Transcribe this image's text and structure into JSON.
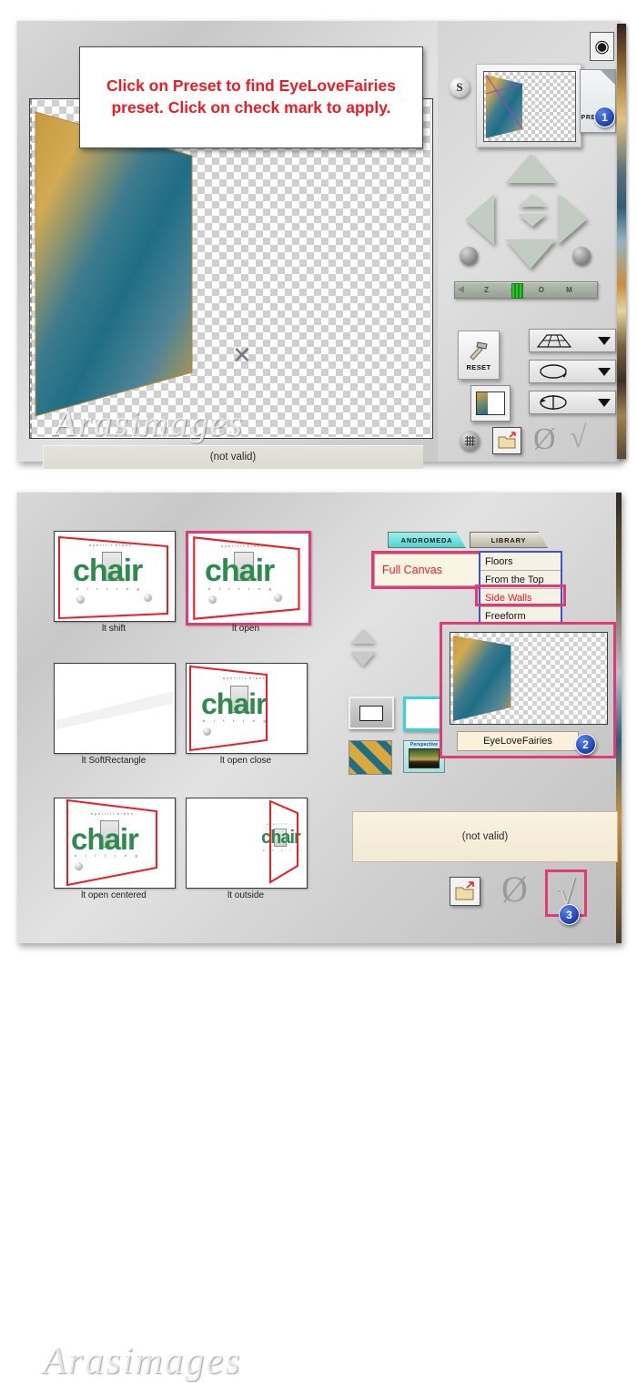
{
  "callout": {
    "text": "Click on Preset to find EyeLoveFairies preset.  Click on check mark to apply.",
    "color": "#ec1c24"
  },
  "top_panel": {
    "s_button_label": "S",
    "camera_icon": "camera-icon",
    "presets_button_label": "PRESETS",
    "presets_badge": "1",
    "zoom_slider_label": "Z O O M",
    "reset_button_label": "RESET",
    "status_text": "(not valid)",
    "watermark": "Arasimages",
    "dropdowns": [
      {
        "name": "perspective-grid-dropdown"
      },
      {
        "name": "rotate-dropdown"
      },
      {
        "name": "flip-dropdown"
      }
    ],
    "actions": [
      {
        "name": "grid-icon"
      },
      {
        "name": "open-folder-icon"
      },
      {
        "name": "cancel-null-icon"
      },
      {
        "name": "apply-check-icon"
      }
    ]
  },
  "bottom_panel": {
    "tabs": [
      {
        "label": "ANDROMEDA",
        "active": true
      },
      {
        "label": "LIBRARY",
        "active": false
      }
    ],
    "category_label": "Full Canvas",
    "menu_items": [
      {
        "label": "Floors",
        "highlighted": false
      },
      {
        "label": "From the Top",
        "highlighted": false
      },
      {
        "label": "Side Walls",
        "highlighted": true
      },
      {
        "label": "Freeform",
        "highlighted": false
      }
    ],
    "thumbnails": [
      {
        "label": "lt shift",
        "selected": false
      },
      {
        "label": "lt open",
        "selected": true
      },
      {
        "label": "lt SoftRectangle",
        "selected": false
      },
      {
        "label": "lt open close",
        "selected": false
      },
      {
        "label": "lt open centered",
        "selected": false
      },
      {
        "label": "lt outside",
        "selected": false
      }
    ],
    "poster_word": "chair",
    "perspective_swatch_label": "Perspective",
    "preset_name": "EyeLoveFairies",
    "preset_badge": "2",
    "status_text": "(not valid)",
    "apply_badge": "3",
    "watermark": "Arasimages"
  },
  "colors": {
    "highlight_pink": "#e03a77",
    "red_text": "#ec1c24",
    "menu_blue": "#3b56c8",
    "badge_blue": "#1d3fae",
    "gradient_gold": "#d8a93e",
    "gradient_teal": "#1f6e86"
  }
}
